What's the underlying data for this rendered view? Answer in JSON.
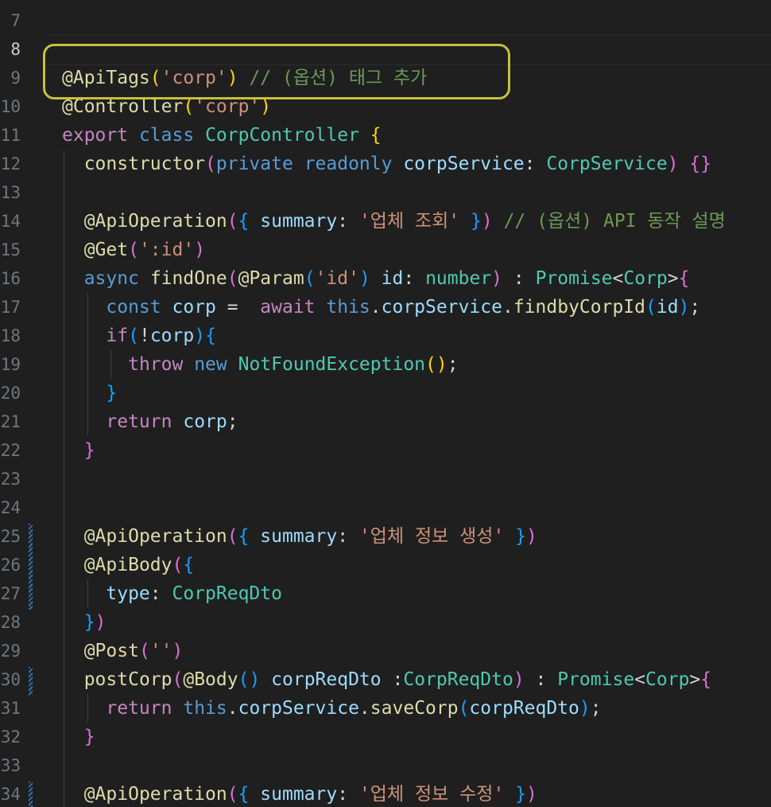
{
  "editor": {
    "line_numbers": [
      "7",
      "8",
      "9",
      "10",
      "11",
      "12",
      "13",
      "14",
      "15",
      "16",
      "17",
      "18",
      "19",
      "20",
      "21",
      "22",
      "23",
      "24",
      "25",
      "26",
      "27",
      "28",
      "29",
      "30",
      "31",
      "32",
      "33",
      "34"
    ],
    "highlight_color": "#c7c03a",
    "modified_indicator_color": "#2f6fb6",
    "lines": {
      "l7": [],
      "l8": [],
      "l9": [
        [
          "fn",
          "@ApiTags"
        ],
        [
          "b1",
          "("
        ],
        [
          "str",
          "'corp'"
        ],
        [
          "b1",
          ")"
        ],
        [
          "pun",
          " "
        ],
        [
          "com",
          "// (옵션) 태그 추가"
        ]
      ],
      "l10": [
        [
          "fn",
          "@Controller"
        ],
        [
          "b1",
          "("
        ],
        [
          "str",
          "'corp'"
        ],
        [
          "b1",
          ")"
        ]
      ],
      "l11": [
        [
          "kw2",
          "export"
        ],
        [
          "pun",
          " "
        ],
        [
          "kw",
          "class"
        ],
        [
          "pun",
          " "
        ],
        [
          "cls",
          "CorpController"
        ],
        [
          "pun",
          " "
        ],
        [
          "b1",
          "{"
        ]
      ],
      "l12": [
        [
          "pun",
          "  "
        ],
        [
          "fn",
          "constructor"
        ],
        [
          "b2",
          "("
        ],
        [
          "kw",
          "private"
        ],
        [
          "pun",
          " "
        ],
        [
          "kw",
          "readonly"
        ],
        [
          "pun",
          " "
        ],
        [
          "var",
          "corpService"
        ],
        [
          "pun",
          ": "
        ],
        [
          "cls",
          "CorpService"
        ],
        [
          "b2",
          ")"
        ],
        [
          "pun",
          " "
        ],
        [
          "b2",
          "{}"
        ]
      ],
      "l13": [],
      "l14": [
        [
          "pun",
          "  "
        ],
        [
          "fn",
          "@ApiOperation"
        ],
        [
          "b2",
          "("
        ],
        [
          "b3",
          "{"
        ],
        [
          "pun",
          " "
        ],
        [
          "var",
          "summary"
        ],
        [
          "pun",
          ": "
        ],
        [
          "str",
          "'업체 조회'"
        ],
        [
          "pun",
          " "
        ],
        [
          "b3",
          "}"
        ],
        [
          "b2",
          ")"
        ],
        [
          "pun",
          " "
        ],
        [
          "com",
          "// (옵션) API 동작 설명"
        ]
      ],
      "l15": [
        [
          "pun",
          "  "
        ],
        [
          "fn",
          "@Get"
        ],
        [
          "b2",
          "("
        ],
        [
          "str",
          "':id'"
        ],
        [
          "b2",
          ")"
        ]
      ],
      "l16": [
        [
          "pun",
          "  "
        ],
        [
          "kw",
          "async"
        ],
        [
          "pun",
          " "
        ],
        [
          "fn",
          "findOne"
        ],
        [
          "b2",
          "("
        ],
        [
          "fn",
          "@Param"
        ],
        [
          "b3",
          "("
        ],
        [
          "str",
          "'id'"
        ],
        [
          "b3",
          ")"
        ],
        [
          "pun",
          " "
        ],
        [
          "var",
          "id"
        ],
        [
          "pun",
          ": "
        ],
        [
          "cls",
          "number"
        ],
        [
          "b2",
          ")"
        ],
        [
          "pun",
          " : "
        ],
        [
          "cls",
          "Promise"
        ],
        [
          "pun",
          "<"
        ],
        [
          "cls",
          "Corp"
        ],
        [
          "pun",
          ">"
        ],
        [
          "b2",
          "{"
        ]
      ],
      "l17": [
        [
          "pun",
          "    "
        ],
        [
          "kw",
          "const"
        ],
        [
          "pun",
          " "
        ],
        [
          "var",
          "corp"
        ],
        [
          "pun",
          " =  "
        ],
        [
          "kw2",
          "await"
        ],
        [
          "pun",
          " "
        ],
        [
          "kw",
          "this"
        ],
        [
          "pun",
          "."
        ],
        [
          "var",
          "corpService"
        ],
        [
          "pun",
          "."
        ],
        [
          "fn",
          "findbyCorpId"
        ],
        [
          "b3",
          "("
        ],
        [
          "var",
          "id"
        ],
        [
          "b3",
          ")"
        ],
        [
          "pun",
          ";"
        ]
      ],
      "l18": [
        [
          "pun",
          "    "
        ],
        [
          "kw2",
          "if"
        ],
        [
          "b3",
          "("
        ],
        [
          "pun",
          "!"
        ],
        [
          "var",
          "corp"
        ],
        [
          "b3",
          ")"
        ],
        [
          "b3",
          "{"
        ]
      ],
      "l19": [
        [
          "pun",
          "      "
        ],
        [
          "kw2",
          "throw"
        ],
        [
          "pun",
          " "
        ],
        [
          "kw",
          "new"
        ],
        [
          "pun",
          " "
        ],
        [
          "cls",
          "NotFoundException"
        ],
        [
          "b1",
          "()"
        ],
        [
          "pun",
          ";"
        ]
      ],
      "l20": [
        [
          "pun",
          "    "
        ],
        [
          "b3",
          "}"
        ]
      ],
      "l21": [
        [
          "pun",
          "    "
        ],
        [
          "kw2",
          "return"
        ],
        [
          "pun",
          " "
        ],
        [
          "var",
          "corp"
        ],
        [
          "pun",
          ";"
        ]
      ],
      "l22": [
        [
          "pun",
          "  "
        ],
        [
          "b2",
          "}"
        ]
      ],
      "l23": [],
      "l24": [],
      "l25": [
        [
          "pun",
          "  "
        ],
        [
          "fn",
          "@ApiOperation"
        ],
        [
          "b2",
          "("
        ],
        [
          "b3",
          "{"
        ],
        [
          "pun",
          " "
        ],
        [
          "var",
          "summary"
        ],
        [
          "pun",
          ": "
        ],
        [
          "str",
          "'업체 정보 생성'"
        ],
        [
          "pun",
          " "
        ],
        [
          "b3",
          "}"
        ],
        [
          "b2",
          ")"
        ]
      ],
      "l26": [
        [
          "pun",
          "  "
        ],
        [
          "fn",
          "@ApiBody"
        ],
        [
          "b2",
          "("
        ],
        [
          "b3",
          "{"
        ]
      ],
      "l27": [
        [
          "pun",
          "    "
        ],
        [
          "var",
          "type"
        ],
        [
          "pun",
          ": "
        ],
        [
          "cls",
          "CorpReqDto"
        ]
      ],
      "l28": [
        [
          "pun",
          "  "
        ],
        [
          "b3",
          "}"
        ],
        [
          "b2",
          ")"
        ]
      ],
      "l29": [
        [
          "pun",
          "  "
        ],
        [
          "fn",
          "@Post"
        ],
        [
          "b2",
          "("
        ],
        [
          "str",
          "''"
        ],
        [
          "b2",
          ")"
        ]
      ],
      "l30": [
        [
          "pun",
          "  "
        ],
        [
          "fn",
          "postCorp"
        ],
        [
          "b2",
          "("
        ],
        [
          "fn",
          "@Body"
        ],
        [
          "b3",
          "()"
        ],
        [
          "pun",
          " "
        ],
        [
          "var",
          "corpReqDto"
        ],
        [
          "pun",
          " :"
        ],
        [
          "cls",
          "CorpReqDto"
        ],
        [
          "b2",
          ")"
        ],
        [
          "pun",
          " : "
        ],
        [
          "cls",
          "Promise"
        ],
        [
          "pun",
          "<"
        ],
        [
          "cls",
          "Corp"
        ],
        [
          "pun",
          ">"
        ],
        [
          "b2",
          "{"
        ]
      ],
      "l31": [
        [
          "pun",
          "    "
        ],
        [
          "kw2",
          "return"
        ],
        [
          "pun",
          " "
        ],
        [
          "kw",
          "this"
        ],
        [
          "pun",
          "."
        ],
        [
          "var",
          "corpService"
        ],
        [
          "pun",
          "."
        ],
        [
          "fn",
          "saveCorp"
        ],
        [
          "b3",
          "("
        ],
        [
          "var",
          "corpReqDto"
        ],
        [
          "b3",
          ")"
        ],
        [
          "pun",
          ";"
        ]
      ],
      "l32": [
        [
          "pun",
          "  "
        ],
        [
          "b2",
          "}"
        ]
      ],
      "l33": [],
      "l34": [
        [
          "pun",
          "  "
        ],
        [
          "fn",
          "@ApiOperation"
        ],
        [
          "b2",
          "("
        ],
        [
          "b3",
          "{"
        ],
        [
          "pun",
          " "
        ],
        [
          "var",
          "summary"
        ],
        [
          "pun",
          ": "
        ],
        [
          "str",
          "'업체 정보 수정'"
        ],
        [
          "pun",
          " "
        ],
        [
          "b3",
          "}"
        ],
        [
          "b2",
          ")"
        ]
      ]
    }
  }
}
